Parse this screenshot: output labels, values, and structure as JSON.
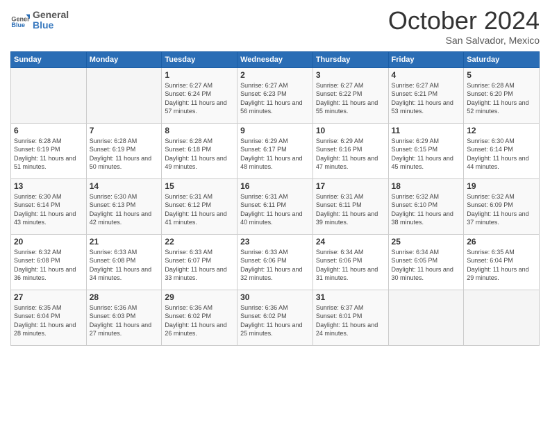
{
  "header": {
    "logo": {
      "line1": "General",
      "line2": "Blue"
    },
    "month": "October 2024",
    "location": "San Salvador, Mexico"
  },
  "days_of_week": [
    "Sunday",
    "Monday",
    "Tuesday",
    "Wednesday",
    "Thursday",
    "Friday",
    "Saturday"
  ],
  "weeks": [
    [
      {
        "day": "",
        "info": ""
      },
      {
        "day": "",
        "info": ""
      },
      {
        "day": "1",
        "info": "Sunrise: 6:27 AM\nSunset: 6:24 PM\nDaylight: 11 hours and 57 minutes."
      },
      {
        "day": "2",
        "info": "Sunrise: 6:27 AM\nSunset: 6:23 PM\nDaylight: 11 hours and 56 minutes."
      },
      {
        "day": "3",
        "info": "Sunrise: 6:27 AM\nSunset: 6:22 PM\nDaylight: 11 hours and 55 minutes."
      },
      {
        "day": "4",
        "info": "Sunrise: 6:27 AM\nSunset: 6:21 PM\nDaylight: 11 hours and 53 minutes."
      },
      {
        "day": "5",
        "info": "Sunrise: 6:28 AM\nSunset: 6:20 PM\nDaylight: 11 hours and 52 minutes."
      }
    ],
    [
      {
        "day": "6",
        "info": "Sunrise: 6:28 AM\nSunset: 6:19 PM\nDaylight: 11 hours and 51 minutes."
      },
      {
        "day": "7",
        "info": "Sunrise: 6:28 AM\nSunset: 6:19 PM\nDaylight: 11 hours and 50 minutes."
      },
      {
        "day": "8",
        "info": "Sunrise: 6:28 AM\nSunset: 6:18 PM\nDaylight: 11 hours and 49 minutes."
      },
      {
        "day": "9",
        "info": "Sunrise: 6:29 AM\nSunset: 6:17 PM\nDaylight: 11 hours and 48 minutes."
      },
      {
        "day": "10",
        "info": "Sunrise: 6:29 AM\nSunset: 6:16 PM\nDaylight: 11 hours and 47 minutes."
      },
      {
        "day": "11",
        "info": "Sunrise: 6:29 AM\nSunset: 6:15 PM\nDaylight: 11 hours and 45 minutes."
      },
      {
        "day": "12",
        "info": "Sunrise: 6:30 AM\nSunset: 6:14 PM\nDaylight: 11 hours and 44 minutes."
      }
    ],
    [
      {
        "day": "13",
        "info": "Sunrise: 6:30 AM\nSunset: 6:14 PM\nDaylight: 11 hours and 43 minutes."
      },
      {
        "day": "14",
        "info": "Sunrise: 6:30 AM\nSunset: 6:13 PM\nDaylight: 11 hours and 42 minutes."
      },
      {
        "day": "15",
        "info": "Sunrise: 6:31 AM\nSunset: 6:12 PM\nDaylight: 11 hours and 41 minutes."
      },
      {
        "day": "16",
        "info": "Sunrise: 6:31 AM\nSunset: 6:11 PM\nDaylight: 11 hours and 40 minutes."
      },
      {
        "day": "17",
        "info": "Sunrise: 6:31 AM\nSunset: 6:11 PM\nDaylight: 11 hours and 39 minutes."
      },
      {
        "day": "18",
        "info": "Sunrise: 6:32 AM\nSunset: 6:10 PM\nDaylight: 11 hours and 38 minutes."
      },
      {
        "day": "19",
        "info": "Sunrise: 6:32 AM\nSunset: 6:09 PM\nDaylight: 11 hours and 37 minutes."
      }
    ],
    [
      {
        "day": "20",
        "info": "Sunrise: 6:32 AM\nSunset: 6:08 PM\nDaylight: 11 hours and 36 minutes."
      },
      {
        "day": "21",
        "info": "Sunrise: 6:33 AM\nSunset: 6:08 PM\nDaylight: 11 hours and 34 minutes."
      },
      {
        "day": "22",
        "info": "Sunrise: 6:33 AM\nSunset: 6:07 PM\nDaylight: 11 hours and 33 minutes."
      },
      {
        "day": "23",
        "info": "Sunrise: 6:33 AM\nSunset: 6:06 PM\nDaylight: 11 hours and 32 minutes."
      },
      {
        "day": "24",
        "info": "Sunrise: 6:34 AM\nSunset: 6:06 PM\nDaylight: 11 hours and 31 minutes."
      },
      {
        "day": "25",
        "info": "Sunrise: 6:34 AM\nSunset: 6:05 PM\nDaylight: 11 hours and 30 minutes."
      },
      {
        "day": "26",
        "info": "Sunrise: 6:35 AM\nSunset: 6:04 PM\nDaylight: 11 hours and 29 minutes."
      }
    ],
    [
      {
        "day": "27",
        "info": "Sunrise: 6:35 AM\nSunset: 6:04 PM\nDaylight: 11 hours and 28 minutes."
      },
      {
        "day": "28",
        "info": "Sunrise: 6:36 AM\nSunset: 6:03 PM\nDaylight: 11 hours and 27 minutes."
      },
      {
        "day": "29",
        "info": "Sunrise: 6:36 AM\nSunset: 6:02 PM\nDaylight: 11 hours and 26 minutes."
      },
      {
        "day": "30",
        "info": "Sunrise: 6:36 AM\nSunset: 6:02 PM\nDaylight: 11 hours and 25 minutes."
      },
      {
        "day": "31",
        "info": "Sunrise: 6:37 AM\nSunset: 6:01 PM\nDaylight: 11 hours and 24 minutes."
      },
      {
        "day": "",
        "info": ""
      },
      {
        "day": "",
        "info": ""
      }
    ]
  ]
}
